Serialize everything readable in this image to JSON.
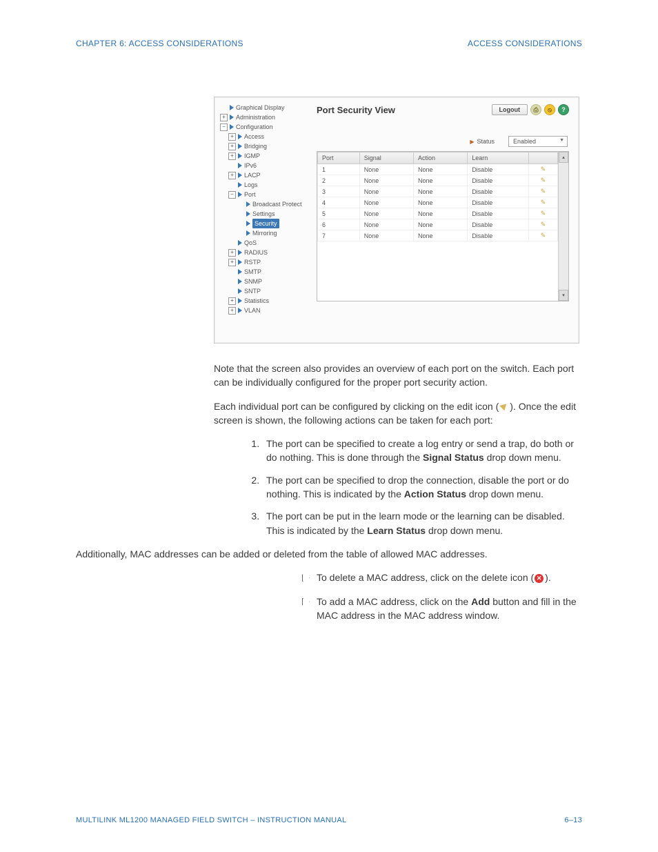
{
  "header": {
    "left": "CHAPTER 6: ACCESS CONSIDERATIONS",
    "right": "ACCESS CONSIDERATIONS"
  },
  "screenshot": {
    "panel_title": "Port Security View",
    "logout": "Logout",
    "status_label": "Status",
    "status_value": "Enabled",
    "tree": [
      {
        "exp": "",
        "label": "Graphical Display"
      },
      {
        "exp": "+",
        "label": "Administration"
      },
      {
        "exp": "-",
        "label": "Configuration",
        "children": [
          {
            "exp": "+",
            "label": "Access"
          },
          {
            "exp": "+",
            "label": "Bridging"
          },
          {
            "exp": "+",
            "label": "IGMP"
          },
          {
            "exp": "",
            "label": "IPv6"
          },
          {
            "exp": "+",
            "label": "LACP"
          },
          {
            "exp": "",
            "label": "Logs"
          },
          {
            "exp": "-",
            "label": "Port",
            "children": [
              {
                "exp": "",
                "label": "Broadcast Protect"
              },
              {
                "exp": "",
                "label": "Settings"
              },
              {
                "exp": "",
                "label": "Security",
                "selected": true
              },
              {
                "exp": "",
                "label": "Mirroring"
              }
            ]
          },
          {
            "exp": "",
            "label": "QoS"
          },
          {
            "exp": "+",
            "label": "RADIUS"
          },
          {
            "exp": "+",
            "label": "RSTP"
          },
          {
            "exp": "",
            "label": "SMTP"
          },
          {
            "exp": "",
            "label": "SNMP"
          },
          {
            "exp": "",
            "label": "SNTP"
          },
          {
            "exp": "+",
            "label": "Statistics"
          },
          {
            "exp": "+",
            "label": "VLAN"
          }
        ]
      }
    ],
    "columns": [
      "Port",
      "Signal",
      "Action",
      "Learn",
      ""
    ],
    "rows": [
      {
        "port": "1",
        "signal": "None",
        "action": "None",
        "learn": "Disable"
      },
      {
        "port": "2",
        "signal": "None",
        "action": "None",
        "learn": "Disable"
      },
      {
        "port": "3",
        "signal": "None",
        "action": "None",
        "learn": "Disable"
      },
      {
        "port": "4",
        "signal": "None",
        "action": "None",
        "learn": "Disable"
      },
      {
        "port": "5",
        "signal": "None",
        "action": "None",
        "learn": "Disable"
      },
      {
        "port": "6",
        "signal": "None",
        "action": "None",
        "learn": "Disable"
      },
      {
        "port": "7",
        "signal": "None",
        "action": "None",
        "learn": "Disable"
      }
    ]
  },
  "body": {
    "p1": "Note that the screen also provides an overview of each port on the switch. Each port can be individually configured for the proper port security action.",
    "p2a": "Each individual port can be configured by clicking on the edit icon (",
    "p2b": "). Once the edit screen is shown, the following actions can be taken for each port:",
    "li1a": "The port can be specified to create a log entry or send a trap, do both or do nothing. This is done through the ",
    "li1b": "Signal Status",
    "li1c": " drop down menu.",
    "li2a": "The port can be specified to drop the connection, disable the port or do nothing. This is indicated by the ",
    "li2b": "Action Status",
    "li2c": " drop down menu.",
    "li3a": "The port can be put in the learn mode or the learning can be disabled. This is indicated by the ",
    "li3b": "Learn Status",
    "li3c": " drop down menu.",
    "p3": "Additionally, MAC addresses can be added or deleted from the table of allowed MAC addresses.",
    "sub1a": "To delete a MAC address, click on the delete icon (",
    "sub1b": ").",
    "sub2a": "To add a MAC address, click on the ",
    "sub2b": "Add",
    "sub2c": " button and fill in the MAC address in the MAC address window."
  },
  "footer": {
    "left": "MULTILINK ML1200 MANAGED FIELD SWITCH – INSTRUCTION MANUAL",
    "right": "6–13"
  }
}
